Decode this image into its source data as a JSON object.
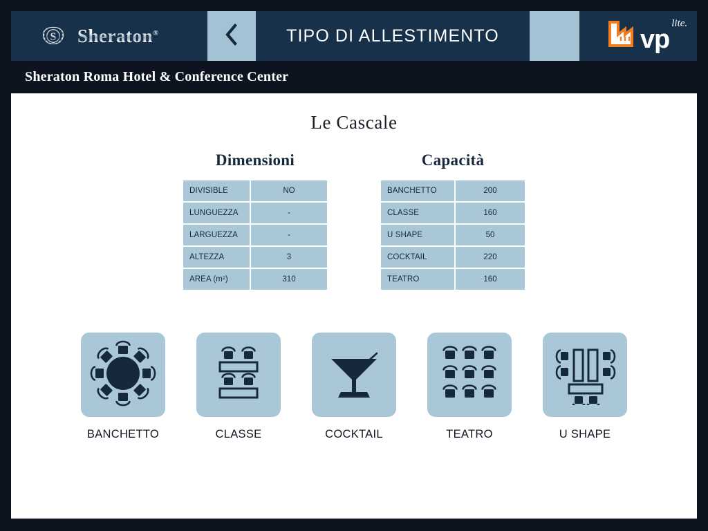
{
  "header": {
    "brand_name": "Sheraton",
    "brand_trademark": "®",
    "brand_seal_icon": "sheraton-laurel-seal-icon",
    "back_icon": "chevron-left-icon",
    "title": "TIPO DI ALLESTIMENTO",
    "blank_button_label": "",
    "vp_logo": {
      "icon": "vp-factory-icon",
      "text": "vp",
      "suffix": "lite."
    }
  },
  "hotel": {
    "name": "Sheraton Roma Hotel & Conference Center"
  },
  "room": {
    "name": "Le Cascale"
  },
  "dimensions": {
    "heading": "Dimensioni",
    "rows": [
      {
        "label": "DIVISIBLE",
        "value": "NO"
      },
      {
        "label": "LUNGUEZZA",
        "value": "-"
      },
      {
        "label": "LARGUEZZA",
        "value": "-"
      },
      {
        "label": "ALTEZZA",
        "value": "3"
      },
      {
        "label": "AREA (m²)",
        "value": "310"
      }
    ]
  },
  "capacity": {
    "heading": "Capacità",
    "rows": [
      {
        "label": "BANCHETTO",
        "value": "200"
      },
      {
        "label": "CLASSE",
        "value": "160"
      },
      {
        "label": "U SHAPE",
        "value": "50"
      },
      {
        "label": "COCKTAIL",
        "value": "220"
      },
      {
        "label": "TEATRO",
        "value": "160"
      }
    ]
  },
  "layouts": [
    {
      "label": "BANCHETTO",
      "icon": "round-table-banquet-icon"
    },
    {
      "label": "CLASSE",
      "icon": "classroom-desks-icon"
    },
    {
      "label": "COCKTAIL",
      "icon": "martini-glass-icon"
    },
    {
      "label": "TEATRO",
      "icon": "theater-seats-grid-icon"
    },
    {
      "label": "U SHAPE",
      "icon": "u-shape-tables-icon"
    }
  ],
  "colors": {
    "page_background": "#0d141f",
    "header_bar": "#17314a",
    "accent_light_blue": "#a9c7d7",
    "icon_navy": "#16283c",
    "content_background": "#ffffff",
    "vp_orange": "#f07d22"
  }
}
